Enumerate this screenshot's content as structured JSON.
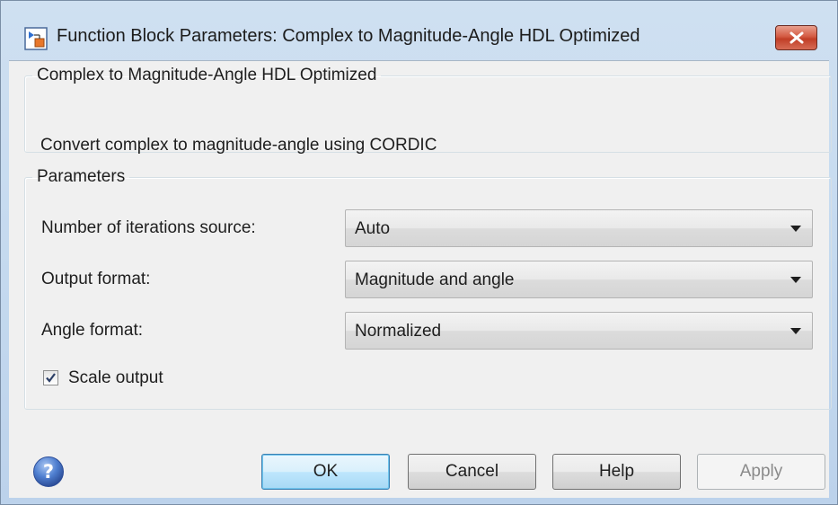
{
  "window": {
    "title": "Function Block Parameters: Complex to Magnitude-Angle HDL Optimized",
    "close_icon": "close-icon",
    "accent": "#c13e26"
  },
  "description": {
    "legend": "Complex to Magnitude-Angle HDL Optimized",
    "text": "Convert complex to magnitude-angle using CORDIC"
  },
  "parameters": {
    "legend": "Parameters",
    "rows": [
      {
        "label": "Number of iterations source:",
        "value": "Auto"
      },
      {
        "label": "Output format:",
        "value": "Magnitude and angle"
      },
      {
        "label": "Angle format:",
        "value": "Normalized"
      }
    ],
    "scale_output": {
      "label": "Scale output",
      "checked": true
    }
  },
  "buttons": {
    "ok": "OK",
    "cancel": "Cancel",
    "help": "Help",
    "apply": "Apply"
  },
  "icons": {
    "app": "simulink-block-icon",
    "help": "help-question-icon",
    "help_color": "#3f68b8"
  }
}
